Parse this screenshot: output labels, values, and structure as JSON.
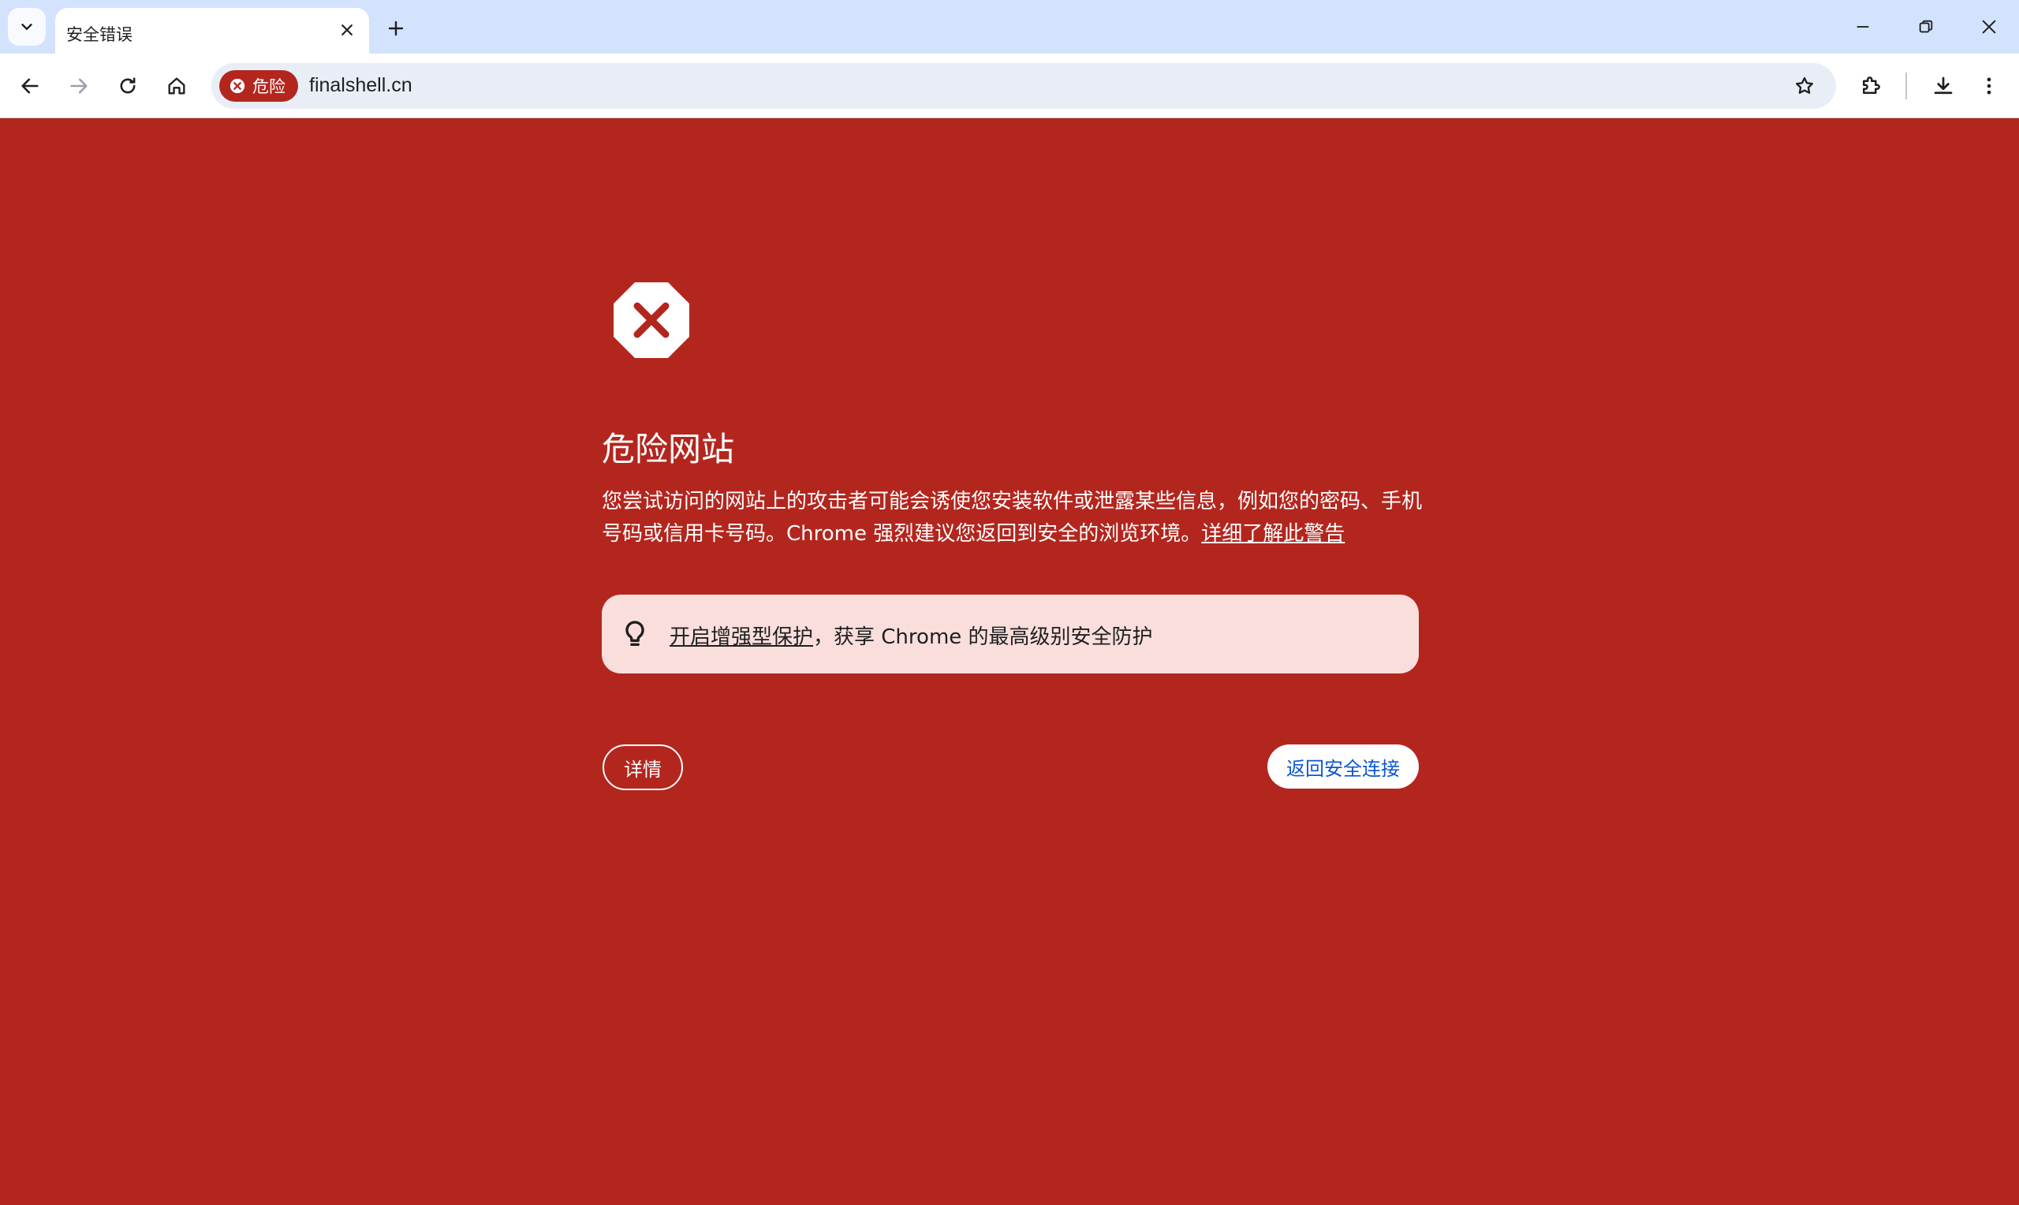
{
  "tab": {
    "title": "安全错误"
  },
  "toolbar": {
    "security_chip_label": "危险",
    "url": "finalshell.cn"
  },
  "page": {
    "heading": "危险网站",
    "description": "您尝试访问的网站上的攻击者可能会诱使您安装软件或泄露某些信息，例如您的密码、手机号码或信用卡号码。Chrome 强烈建议您返回到安全的浏览环境。",
    "learn_more_link": "详细了解此警告",
    "callout_link": "开启增强型保护",
    "callout_text": "，获享 Chrome 的最高级别安全防护",
    "details_button": "详情",
    "back_button": "返回安全连接"
  },
  "colors": {
    "danger_background": "#b3261e",
    "titlebar": "#d3e3fd",
    "callout_background": "#f9dedc",
    "primary_button_text": "#0b57d0"
  },
  "icons": {
    "tab_search": "chevron-down-icon",
    "tab_close": "close-icon",
    "new_tab": "plus-icon",
    "minimize": "minimize-icon",
    "restore": "restore-icon",
    "close_window": "close-icon",
    "back": "arrow-left-icon",
    "forward": "arrow-right-icon",
    "reload": "reload-icon",
    "home": "home-icon",
    "security_danger": "danger-icon",
    "bookmark": "star-icon",
    "extensions": "puzzle-icon",
    "downloads": "download-icon",
    "menu": "more-vert-icon",
    "page_warning": "stop-sign-icon",
    "callout": "lightbulb-icon"
  }
}
